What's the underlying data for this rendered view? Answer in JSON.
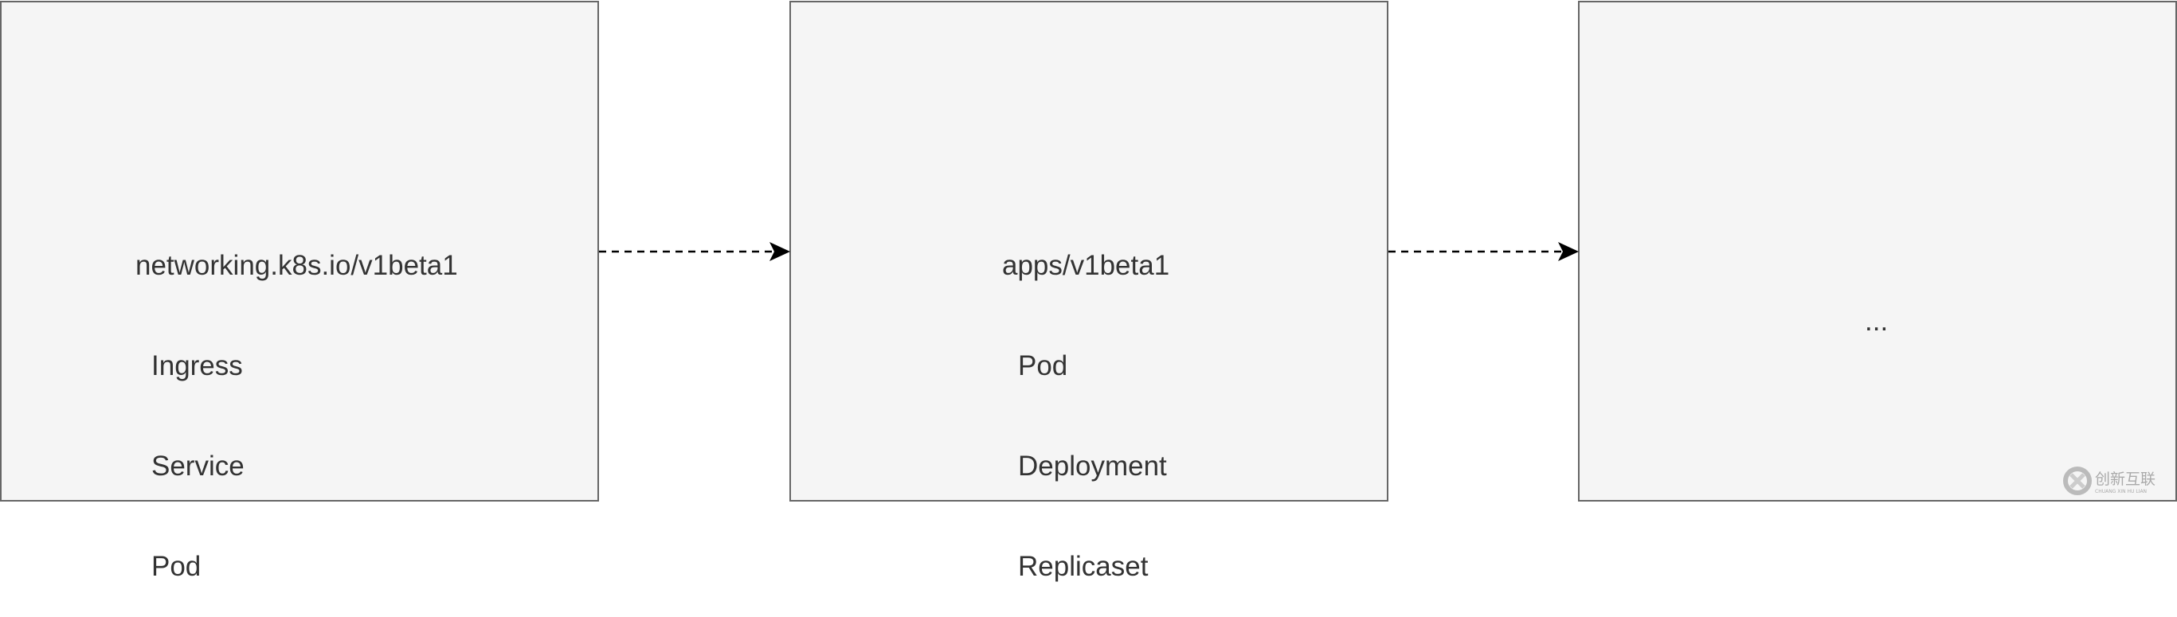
{
  "boxes": [
    {
      "title": "networking.k8s.io/v1beta1",
      "items": [
        "Ingress",
        "Service",
        "Pod"
      ]
    },
    {
      "title": "apps/v1beta1",
      "items": [
        "Pod",
        "Deployment",
        "Replicaset"
      ]
    },
    {
      "title": "...",
      "items": []
    }
  ],
  "edges": [
    {
      "from": 0,
      "to": 1,
      "style": "dashed"
    },
    {
      "from": 1,
      "to": 2,
      "style": "dashed"
    }
  ],
  "colors": {
    "box_fill": "#f5f5f5",
    "box_stroke": "#666666",
    "text": "#333333",
    "arrow": "#000000"
  },
  "watermark": {
    "text": "创新互联",
    "subtext": "CHUANG XIN HU LIAN"
  }
}
